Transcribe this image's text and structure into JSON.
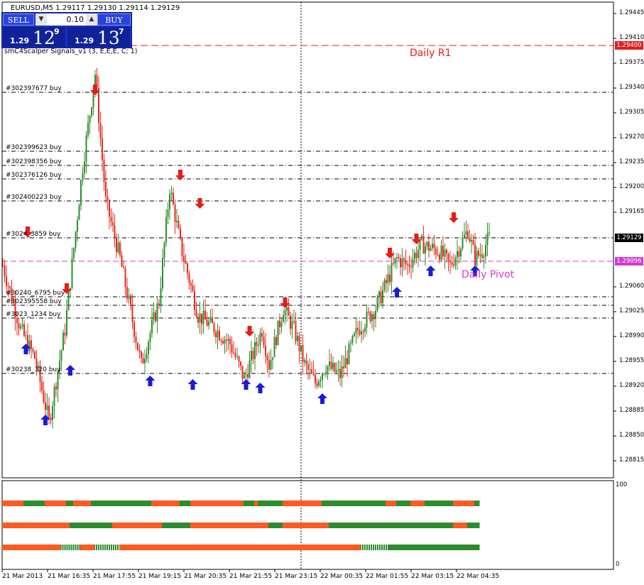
{
  "symbol_header": "EURUSD,M5  1.29117 1.29130 1.29114 1.29129",
  "indicator_header": "smC4Scalper Signals_v1 (3, E,E,E, C; 1)",
  "trade_panel": {
    "sell_label": "SELL",
    "buy_label": "BUY",
    "lot": "0.10",
    "bid_prefix": "1.29",
    "bid_big": "12",
    "bid_sup": "9",
    "ask_prefix": "1.29",
    "ask_big": "13",
    "ask_sup": "7"
  },
  "colors": {
    "bull": "#2d8c2d",
    "bear": "#e8281e",
    "up_arrow": "#1a1ad9",
    "down_arrow": "#e81a1a",
    "r1": "#e21d1d",
    "pivot": "#d13bd1",
    "bar_green": "#2d8c2d",
    "bar_orange": "#ff5a1f",
    "grid": "#9a9a9a"
  },
  "chart_data": {
    "type": "candlestick",
    "y_ticks": [
      "1.29445",
      "1.29410",
      "1.29375",
      "1.29340",
      "1.29305",
      "1.29270",
      "1.29235",
      "1.29200",
      "1.29165",
      "1.29060",
      "1.29025",
      "1.28990",
      "1.28955",
      "1.28920",
      "1.28885",
      "1.28850",
      "1.28815"
    ],
    "ylim": [
      1.28815,
      1.29445
    ],
    "x_ticks": [
      "21 Mar 2013",
      "21 Mar 16:35",
      "21 Mar 17:55",
      "21 Mar 19:15",
      "21 Mar 20:35",
      "21 Mar 21:55",
      "21 Mar 23:15",
      "22 Mar 00:35",
      "22 Mar 01:55",
      "22 Mar 03:15",
      "22 Mar 04:35"
    ],
    "current_price": {
      "label": "1.29129",
      "value": 1.29129
    },
    "daily_r1": {
      "label": "Daily R1",
      "price_label": "1.29400",
      "value": 1.294
    },
    "daily_pivot": {
      "label": "Daily Pivot",
      "price_label": "1.29096",
      "value": 1.29096
    },
    "trade_lines": [
      {
        "label": "#302397677 buy",
        "value": 1.29334
      },
      {
        "label": "#302399623 buy",
        "value": 1.29251
      },
      {
        "label": "#302398356 buy",
        "value": 1.29231
      },
      {
        "label": "#302376126 buy",
        "value": 1.29212
      },
      {
        "label": "#302400223 buy",
        "value": 1.29181
      },
      {
        "label": "#3024_3859 buy",
        "value": 1.29129
      },
      {
        "label": "#30240_6795 buy",
        "value": 1.29046
      },
      {
        "label": "#302395558 buy",
        "value": 1.29034
      },
      {
        "label": "#3023_1234 buy",
        "value": 1.29016
      },
      {
        "label": "#30238_320 buy",
        "value": 1.28938
      }
    ],
    "waypoints": [
      [
        0,
        1.2909
      ],
      [
        10,
        1.29
      ],
      [
        18,
        1.2896
      ],
      [
        26,
        1.2887
      ],
      [
        35,
        1.29
      ],
      [
        45,
        1.2923
      ],
      [
        52,
        1.2936
      ],
      [
        58,
        1.2918
      ],
      [
        66,
        1.291
      ],
      [
        78,
        1.2895
      ],
      [
        88,
        1.2904
      ],
      [
        94,
        1.292
      ],
      [
        100,
        1.2912
      ],
      [
        110,
        1.2902
      ],
      [
        120,
        1.29
      ],
      [
        128,
        1.2898
      ],
      [
        136,
        1.2893
      ],
      [
        146,
        1.29
      ],
      [
        150,
        1.2895
      ],
      [
        158,
        1.2903
      ],
      [
        164,
        1.29
      ],
      [
        170,
        1.2895
      ],
      [
        176,
        1.28925
      ],
      [
        182,
        1.2895
      ],
      [
        190,
        1.28935
      ],
      [
        200,
        1.29
      ],
      [
        210,
        1.2903
      ],
      [
        222,
        1.291
      ],
      [
        228,
        1.2909
      ],
      [
        236,
        1.2912
      ],
      [
        246,
        1.2911
      ],
      [
        252,
        1.2909
      ],
      [
        258,
        1.2912
      ],
      [
        262,
        1.2914
      ],
      [
        266,
        1.291
      ],
      [
        270,
        1.2911
      ],
      [
        274,
        1.29129
      ]
    ],
    "up_arrows": [
      [
        13,
        1.2898
      ],
      [
        24,
        1.2888
      ],
      [
        38,
        1.2895
      ],
      [
        83,
        1.28935
      ],
      [
        107,
        1.2893
      ],
      [
        137,
        1.2893
      ],
      [
        145,
        1.28925
      ],
      [
        180,
        1.2891
      ],
      [
        222,
        1.2906
      ],
      [
        241,
        1.2909
      ],
      [
        266,
        1.2909
      ]
    ],
    "down_arrows": [
      [
        14,
        1.2913
      ],
      [
        36,
        1.2905
      ],
      [
        52,
        1.2933
      ],
      [
        100,
        1.2921
      ],
      [
        111,
        1.2917
      ],
      [
        139,
        1.2899
      ],
      [
        159,
        1.2903
      ],
      [
        218,
        1.291
      ],
      [
        233,
        1.2912
      ],
      [
        254,
        1.2915
      ]
    ],
    "sub_panel": {
      "y_labels": [
        "100",
        "0"
      ],
      "rows": [
        [
          [
            "o",
            0,
            12
          ],
          [
            "g",
            12,
            24
          ],
          [
            "o",
            24,
            36
          ],
          [
            "g",
            36,
            40
          ],
          [
            "o",
            40,
            50
          ],
          [
            "g",
            50,
            84
          ],
          [
            "o",
            84,
            100
          ],
          [
            "g",
            100,
            106
          ],
          [
            "o",
            106,
            136
          ],
          [
            "g",
            136,
            142
          ],
          [
            "o",
            142,
            144
          ],
          [
            "g",
            144,
            158
          ],
          [
            "o",
            158,
            180
          ],
          [
            "g",
            180,
            216
          ],
          [
            "o",
            216,
            222
          ],
          [
            "g",
            222,
            230
          ],
          [
            "o",
            230,
            238
          ],
          [
            "g",
            238,
            254
          ],
          [
            "o",
            254,
            266
          ],
          [
            "g",
            266,
            269
          ]
        ],
        [
          [
            "o",
            0,
            38
          ],
          [
            "g",
            38,
            62
          ],
          [
            "o",
            62,
            90
          ],
          [
            "g",
            90,
            106
          ],
          [
            "o",
            106,
            150
          ],
          [
            "g",
            150,
            158
          ],
          [
            "o",
            158,
            184
          ],
          [
            "g",
            184,
            254
          ],
          [
            "o",
            254,
            262
          ],
          [
            "g",
            262,
            269
          ]
        ],
        [
          [
            "o",
            0,
            33
          ],
          [
            "s",
            33,
            44
          ],
          [
            "o",
            44,
            52
          ],
          [
            "s",
            52,
            66
          ],
          [
            "o",
            66,
            202
          ],
          [
            "s",
            202,
            218
          ],
          [
            "g",
            218,
            269
          ]
        ]
      ]
    }
  }
}
